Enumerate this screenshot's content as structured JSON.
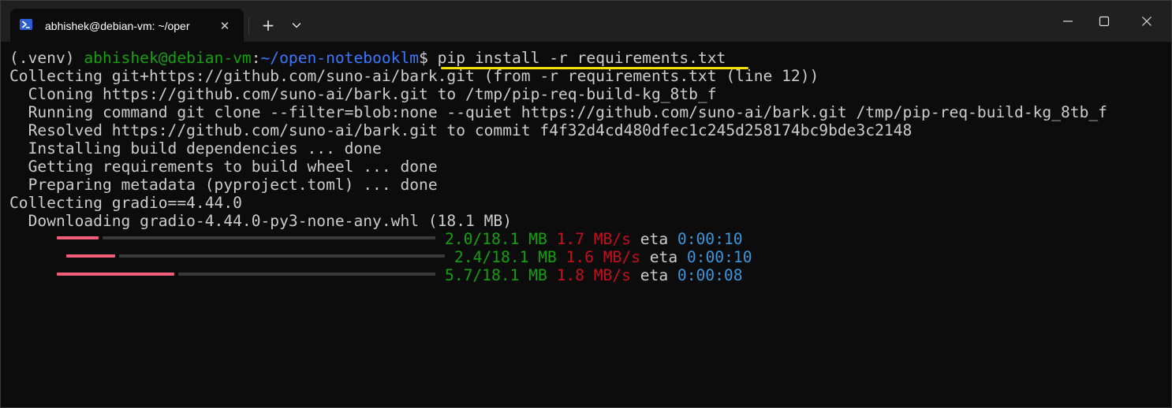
{
  "window": {
    "tab_title": "abhishek@debian-vm: ~/oper",
    "tab_close_glyph": "✕",
    "new_tab_glyph": "+",
    "icons": {
      "tab": "powershell-icon",
      "dropdown": "chevron-down-icon",
      "minimize": "minimize-icon",
      "maximize": "maximize-icon",
      "close": "close-icon"
    }
  },
  "colors": {
    "prompt_user": "#13a10e",
    "prompt_path": "#3b78ff",
    "progress_filled": "#f25e7a",
    "size_text": "#13a10e",
    "speed_text": "#c50f1f",
    "eta_text": "#3a96dd",
    "highlight_underline": "#f5e000"
  },
  "terminal": {
    "prompt": {
      "venv": "(.venv) ",
      "user_host": "abhishek@debian-vm",
      "colon": ":",
      "path": "~/open-notebooklm",
      "dollar": "$ ",
      "command": "pip install -r requirements.txt"
    },
    "lines": [
      "Collecting git+https://github.com/suno-ai/bark.git (from -r requirements.txt (line 12))",
      "  Cloning https://github.com/suno-ai/bark.git to /tmp/pip-req-build-kg_8tb_f",
      "  Running command git clone --filter=blob:none --quiet https://github.com/suno-ai/bark.git /tmp/pip-req-build-kg_8tb_f",
      "  Resolved https://github.com/suno-ai/bark.git to commit f4f32d4cd480dfec1c245d258174bc9bde3c2148",
      "  Installing build dependencies ... done",
      "  Getting requirements to build wheel ... done",
      "  Preparing metadata (pyproject.toml) ... done",
      "Collecting gradio==4.44.0",
      "  Downloading gradio-4.44.0-py3-none-any.whl (18.1 MB)"
    ],
    "progress": [
      {
        "fraction": 0.11,
        "size": "2.0/18.1 MB",
        "speed": "1.7 MB/s",
        "eta_label": "eta",
        "eta": "0:00:10"
      },
      {
        "fraction": 0.13,
        "size": "2.4/18.1 MB",
        "speed": "1.6 MB/s",
        "eta_label": "eta",
        "eta": "0:00:10"
      },
      {
        "fraction": 0.31,
        "size": "5.7/18.1 MB",
        "speed": "1.8 MB/s",
        "eta_label": "eta",
        "eta": "0:00:08"
      }
    ]
  }
}
